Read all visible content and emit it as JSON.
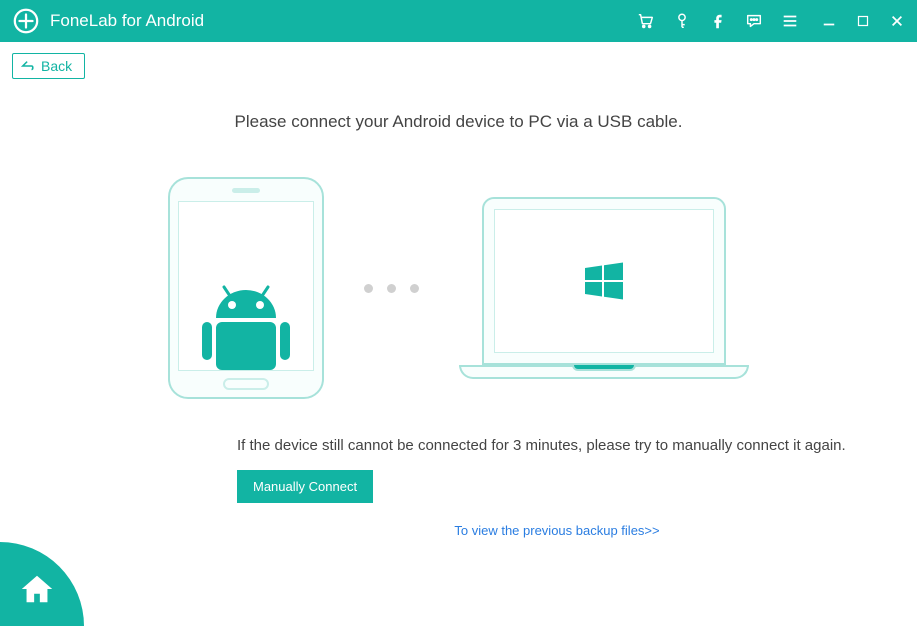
{
  "app": {
    "title": "FoneLab for Android"
  },
  "nav": {
    "back_label": "Back"
  },
  "main": {
    "instruction": "Please connect your Android device to PC via a USB cable.",
    "timeout_hint": "If the device still cannot be connected for 3 minutes, please try to manually connect it again.",
    "manual_connect_label": "Manually Connect",
    "backup_link_label": "To view the previous backup files>>"
  }
}
